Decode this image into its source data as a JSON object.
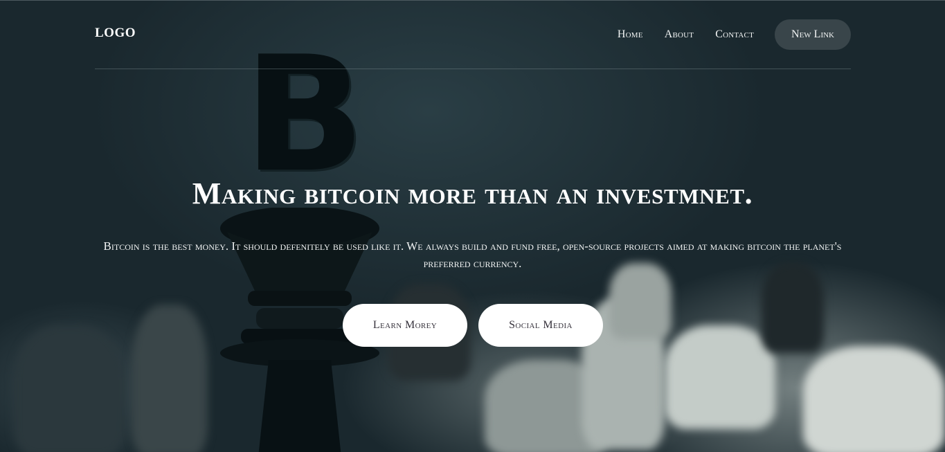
{
  "header": {
    "logo": "LOGO",
    "nav": [
      "Home",
      "About",
      "Contact"
    ],
    "cta": "New Link"
  },
  "hero": {
    "headline": "Making bitcoin more than an investmnet.",
    "subtext": "Bitcoin is the best money. It should defenitely be used like it. We always build and fund free, open-source projects aimed at making bitcoin the planet's preferred currency.",
    "buttons": [
      "Learn Morey",
      "Social Media"
    ],
    "background_icon": "bitcoin-chess-king-icon"
  },
  "colors": {
    "background": "#1c2a31",
    "text": "#ffffff",
    "nav_cta_bg": "#40494f",
    "button_bg": "#ffffff",
    "button_text": "#34303a"
  }
}
